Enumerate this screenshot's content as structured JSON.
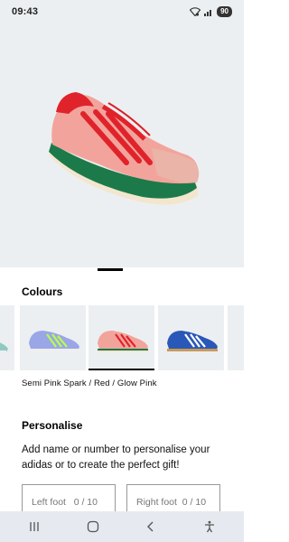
{
  "status_bar": {
    "time": "09:43",
    "battery": "90"
  },
  "product": {
    "colours_heading": "Colours",
    "selected_colour_name": "Semi Pink Spark / Red / Glow Pink",
    "swatches": [
      {
        "colour": "#8fc9c2",
        "accent": "#ffffff"
      },
      {
        "colour": "#9aa6e6",
        "accent": "#b7ff4a"
      },
      {
        "colour": "#f2a49c",
        "accent": "#e0232b"
      },
      {
        "colour": "#2a58b8",
        "accent": "#ffffff"
      }
    ]
  },
  "personalise": {
    "heading": "Personalise",
    "description": "Add name or number to personalise your adidas or to create the perfect gift!",
    "left_foot_placeholder": "Left foot   0 / 10",
    "right_foot_placeholder": "Right foot  0 / 10"
  },
  "colors": {
    "hero_bg": "#eceff1",
    "accent_red": "#e0232b",
    "shoe_pink": "#f2a49c"
  },
  "nav": {
    "icons": [
      "recents-icon",
      "home-icon",
      "back-icon",
      "accessibility-icon"
    ]
  }
}
